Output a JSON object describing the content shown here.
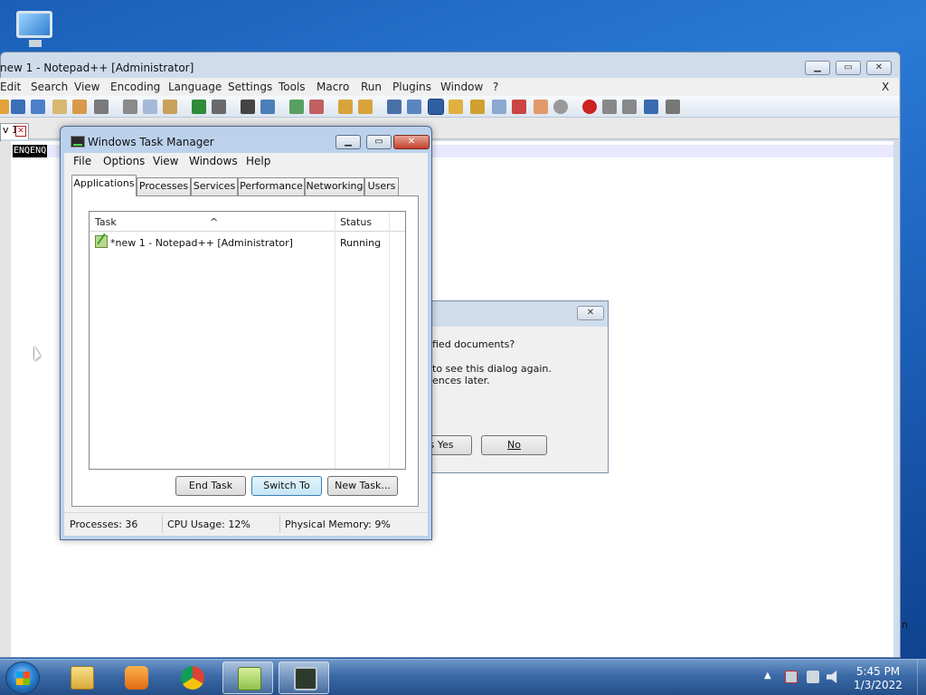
{
  "desktop": {
    "icon_name": "computer-icon"
  },
  "notepad": {
    "title": "new 1 - Notepad++ [Administrator]",
    "menu": [
      "Edit",
      "Search",
      "View",
      "Encoding",
      "Language",
      "Settings",
      "Tools",
      "Macro",
      "Run",
      "Plugins",
      "Window",
      "?"
    ],
    "menu_close": "X",
    "tab_label": "v 1",
    "tab_close": "✕",
    "editor_text": "ENQENQ",
    "right_fragment": "n",
    "window_buttons": {
      "minimize": "▁",
      "maximize": "▭",
      "close": "✕"
    }
  },
  "save_dialog": {
    "close": "✕",
    "line1": "fied documents?",
    "line2": "to see this dialog again.",
    "line3": "ences later.",
    "yes_label": "s Yes",
    "no_label": "No"
  },
  "task_manager": {
    "title": "Windows Task Manager",
    "window_buttons": {
      "minimize": "▁",
      "maximize": "▭",
      "close": "✕"
    },
    "menu": [
      "File",
      "Options",
      "View",
      "Windows",
      "Help"
    ],
    "tabs": [
      "Applications",
      "Processes",
      "Services",
      "Performance",
      "Networking",
      "Users"
    ],
    "columns": {
      "task": "Task",
      "status": "Status",
      "sort_indicator": "^"
    },
    "rows": [
      {
        "task": "*new 1 - Notepad++ [Administrator]",
        "status": "Running"
      }
    ],
    "buttons": {
      "end_task": "End Task",
      "switch_to": "Switch To",
      "new_task": "New Task..."
    },
    "status_bar": {
      "processes": "Processes: 36",
      "cpu": "CPU Usage: 12%",
      "memory": "Physical Memory: 9%"
    }
  },
  "taskbar": {
    "time": "5:45 PM",
    "date": "1/3/2022",
    "tray_arrow": "▲",
    "pinned": [
      "explorer",
      "media-player",
      "chrome",
      "notepad-plus-plus",
      "task-manager"
    ]
  }
}
